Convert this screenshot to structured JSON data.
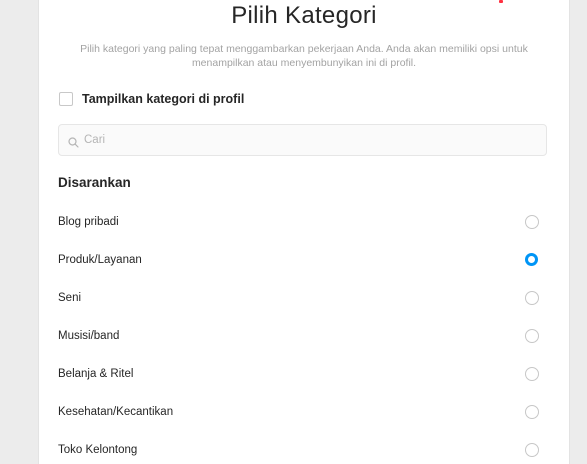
{
  "title": "Pilih Kategori",
  "description": "Pilih kategori yang paling tepat menggambarkan pekerjaan Anda. Anda akan memiliki opsi untuk menampilkan atau menyembunyikan ini di profil.",
  "show_category": {
    "label": "Tampilkan kategori di profil",
    "checked": false
  },
  "search": {
    "placeholder": "Cari",
    "value": ""
  },
  "section_title": "Disarankan",
  "categories": [
    {
      "label": "Blog pribadi",
      "selected": false
    },
    {
      "label": "Produk/Layanan",
      "selected": true
    },
    {
      "label": "Seni",
      "selected": false
    },
    {
      "label": "Musisi/band",
      "selected": false
    },
    {
      "label": "Belanja & Ritel",
      "selected": false
    },
    {
      "label": "Kesehatan/Kecantikan",
      "selected": false
    },
    {
      "label": "Toko Kelontong",
      "selected": false
    }
  ],
  "colors": {
    "accent": "#0095f6",
    "notification": "#ff3040"
  }
}
